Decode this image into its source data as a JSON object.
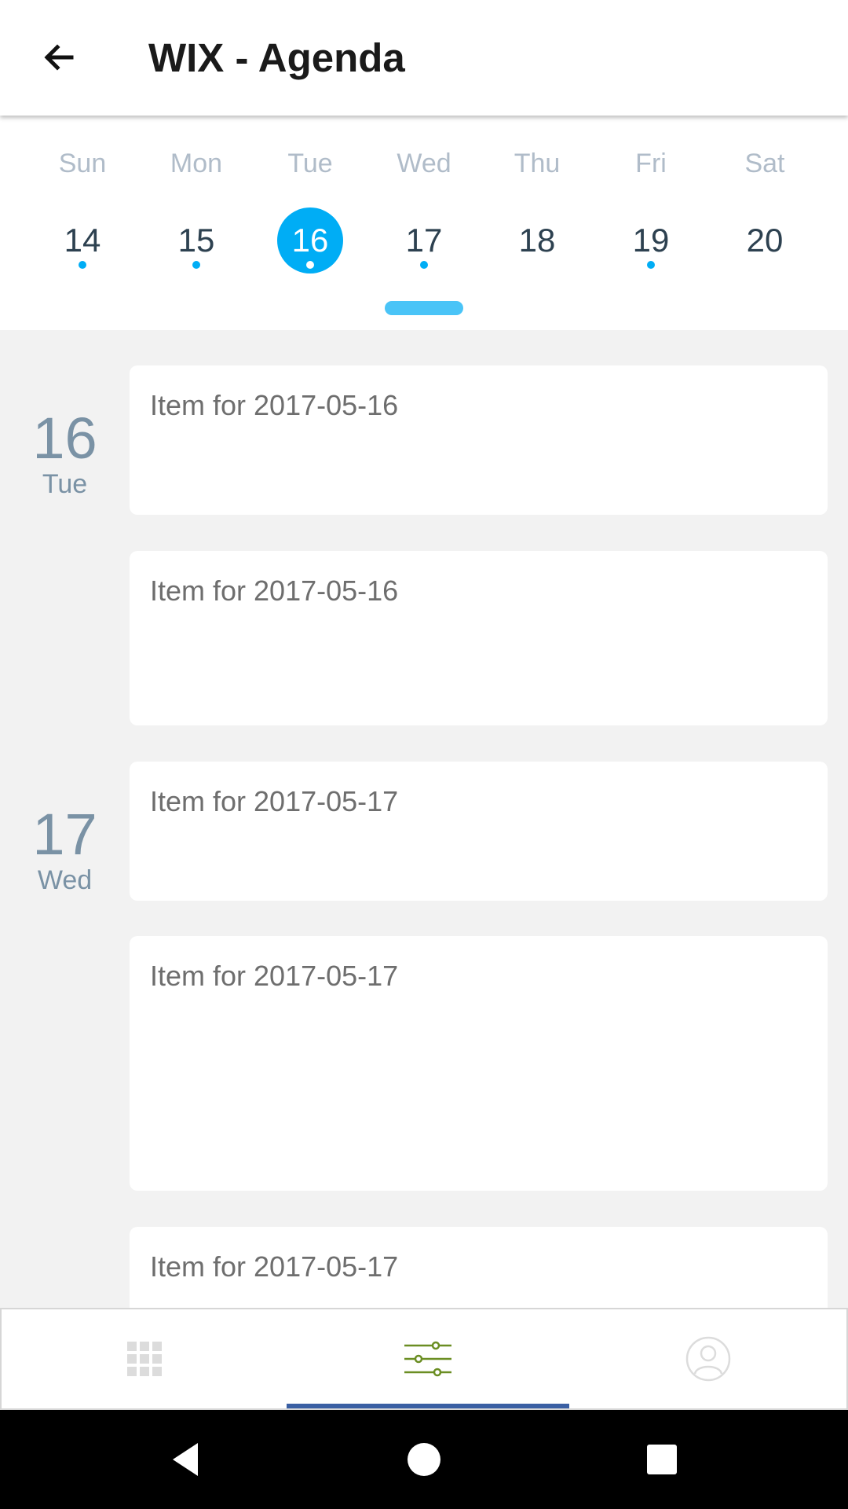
{
  "app_bar": {
    "title": "WIX - Agenda",
    "back_icon": "arrow-left-icon"
  },
  "week": {
    "days": [
      {
        "name": "Sun",
        "number": "14",
        "has_events": true,
        "selected": false
      },
      {
        "name": "Mon",
        "number": "15",
        "has_events": true,
        "selected": false
      },
      {
        "name": "Tue",
        "number": "16",
        "has_events": true,
        "selected": true
      },
      {
        "name": "Wed",
        "number": "17",
        "has_events": true,
        "selected": false
      },
      {
        "name": "Thu",
        "number": "18",
        "has_events": false,
        "selected": false
      },
      {
        "name": "Fri",
        "number": "19",
        "has_events": true,
        "selected": false
      },
      {
        "name": "Sat",
        "number": "20",
        "has_events": false,
        "selected": false
      }
    ],
    "accent_color": "#00adf5"
  },
  "agenda": {
    "groups": [
      {
        "day_number": "16",
        "day_name": "Tue",
        "items": [
          "Item for 2017-05-16",
          "Item for 2017-05-16"
        ]
      },
      {
        "day_number": "17",
        "day_name": "Wed",
        "items": [
          "Item for 2017-05-17",
          "Item for 2017-05-17",
          "Item for 2017-05-17"
        ]
      }
    ]
  },
  "tab_bar": {
    "tabs": [
      {
        "icon": "grid-icon",
        "active": false
      },
      {
        "icon": "sliders-icon",
        "active": true
      },
      {
        "icon": "user-icon",
        "active": false
      }
    ],
    "indicator_color": "#3a5fa3"
  },
  "system_nav": {
    "buttons": [
      "back-triangle-icon",
      "home-circle-icon",
      "recents-square-icon"
    ]
  }
}
